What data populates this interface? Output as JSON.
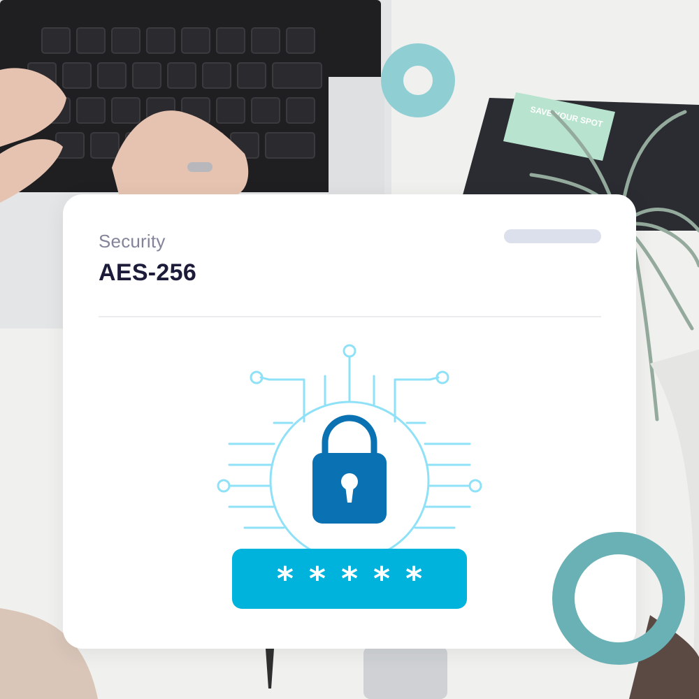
{
  "card": {
    "label": "Security",
    "title": "AES-256"
  },
  "password": {
    "mask": "*****"
  },
  "background_note_text": "SAVE YOUR SPOT",
  "colors": {
    "accent_cyan": "#00b3dc",
    "lock_blue": "#0a72b3",
    "circuit_light": "#8fe1f7",
    "ring_light": "#8fcfd4",
    "ring_dark": "#69b1b4",
    "note_green": "#b8e3cf"
  },
  "icons": [
    "lock-icon",
    "circuit-icon"
  ]
}
